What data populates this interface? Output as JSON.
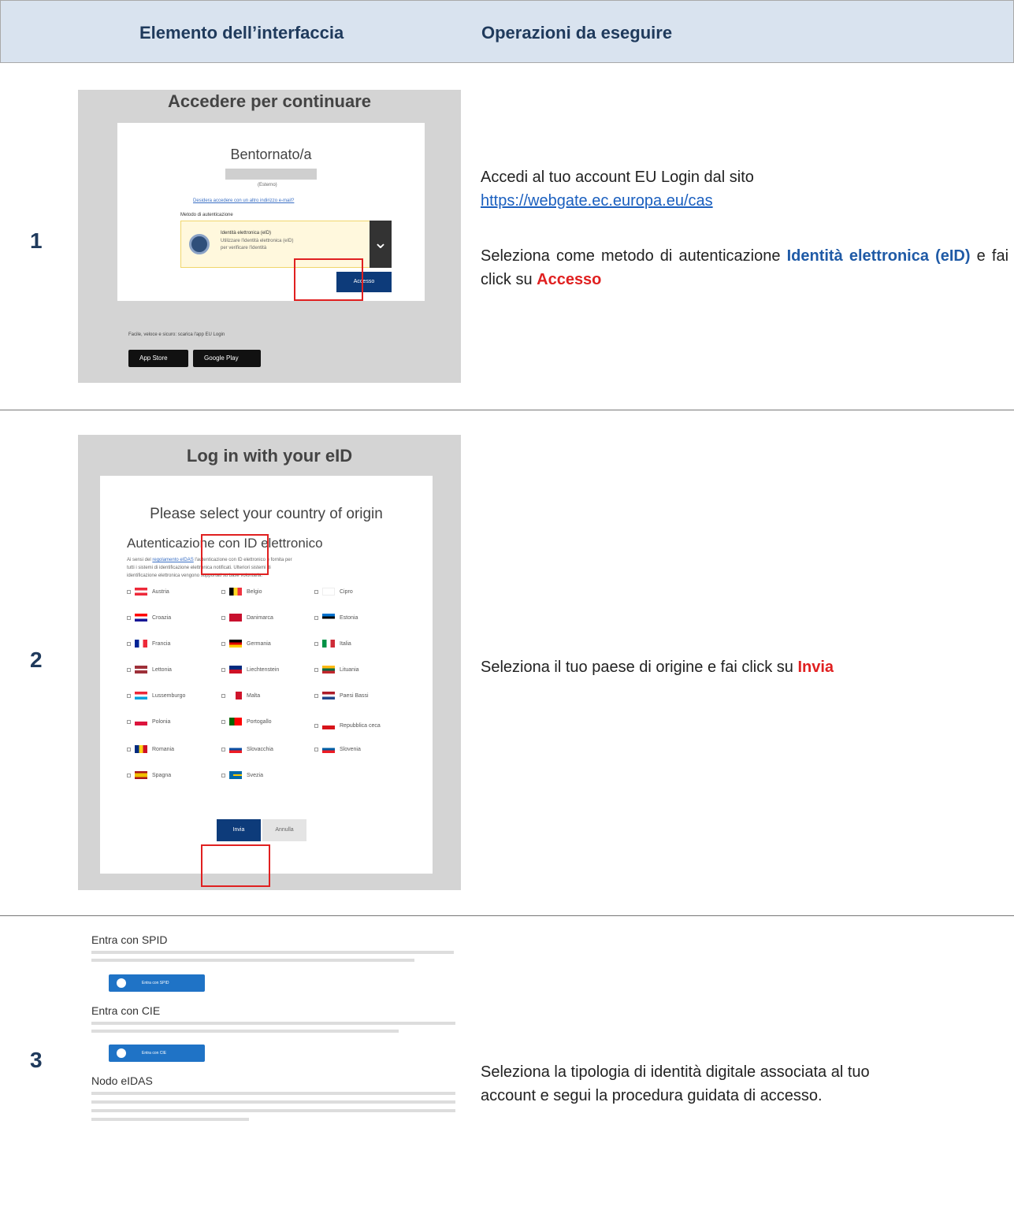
{
  "header": {
    "col1": "Elemento dell’interfaccia",
    "col2": "Operazioni da eseguire"
  },
  "rows": [
    {
      "number": "1",
      "line1": "Accedi al tuo account EU Login dal sito",
      "link": "https://webgate.ec.europa.eu/cas",
      "line2_prefix": "Seleziona come metodo di autenticazione ",
      "line2_blue": "Identità elettronica (eID)",
      "line2_mid": " e fai click su ",
      "line2_red": "Accesso"
    },
    {
      "number": "2",
      "text_prefix": "Seleziona il tuo paese di origine e fai click su ",
      "text_red": "Invia"
    },
    {
      "number": "3",
      "line1": "Seleziona la tipologia di identità digitale associata al tuo",
      "line2": "account e segui la procedura guidata di accesso."
    }
  ],
  "screen1": {
    "title": "Accedere per continuare",
    "welcome": "Bentornato/a",
    "esterno": "(Esterno)",
    "other_link": "Desidera accedere con un altro indirizzo e-mail?",
    "method_label": "Metodo di autenticazione",
    "method_name": "Identità elettronica (eID)",
    "method_desc1": "Utilizzare l'identità elettronica (eID)",
    "method_desc2": "per verificare l'identità",
    "login_button": "Accesso",
    "app_text": "Facile, veloce e sicuro: scarica l'app EU Login",
    "app_store": "App Store",
    "google_play": "Google Play"
  },
  "screen2": {
    "title": "Log in with your eID",
    "subtitle": "Please select your country of origin",
    "auth_title": "Autenticazione con ID elettronico",
    "intro_prefix": "Ai sensi del ",
    "intro_link": "regolamento eIDAS",
    "intro_rest": " l'autenticazione con ID elettronico è fornita per",
    "intro_line2": "tutti i sistemi di identificazione elettronica notificati. Ulteriori sistemi di",
    "intro_line3": "identificazione elettronica vengono supportati su base volontaria.",
    "countries": [
      "Austria",
      "Belgio",
      "Cipro",
      "Croazia",
      "Danimarca",
      "Estonia",
      "Francia",
      "Germania",
      "Italia",
      "Lettonia",
      "Liechtenstein",
      "Lituania",
      "Lussemburgo",
      "Malta",
      "Paesi Bassi",
      "Polonia",
      "Portogallo",
      "Repubblica ceca",
      "Romania",
      "Slovacchia",
      "Slovenia",
      "Spagna",
      "Svezia"
    ],
    "submit": "Invia",
    "cancel": "Annulla"
  },
  "screen3": {
    "spid_title": "Entra con SPID",
    "spid_button": "Entra con SPID",
    "cie_title": "Entra con CIE",
    "cie_button": "Entra con CIE",
    "eidas_title": "Nodo eIDAS"
  },
  "colors": {
    "accent_blue": "#1f5aa6",
    "accent_red": "#e02020",
    "header_bg": "#d9e3ef"
  }
}
